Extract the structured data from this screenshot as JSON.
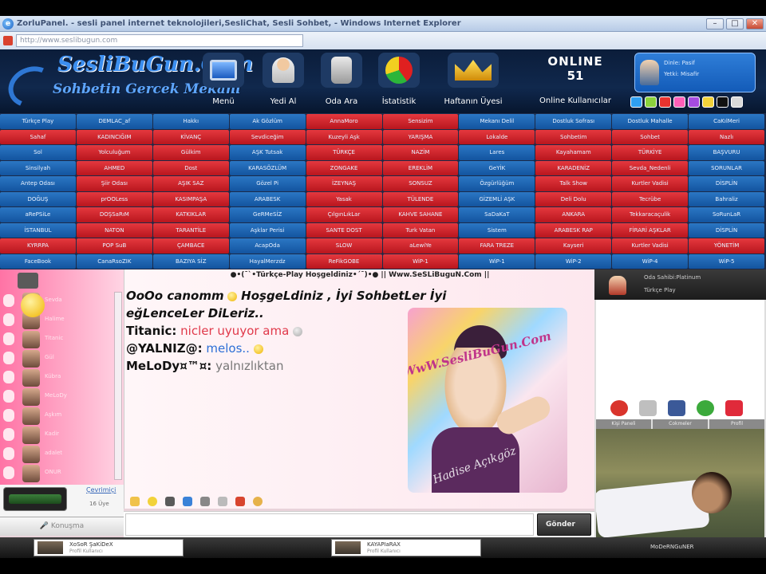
{
  "window": {
    "title": "ZorluPanel. - sesli panel internet teknolojileri,SesliChat, Sesli Sohbet, - Windows Internet Explorer",
    "url": "http://www.seslibugun.com"
  },
  "header": {
    "logo_line1": "SesliBuGun.Com",
    "logo_line2": "Sohbetin Gercek Mekani",
    "nav": [
      "Menü",
      "Yedi Al",
      "Oda Ara",
      "İstatistik",
      "Haftanın Üyesi",
      "Online Kullanıcılar"
    ],
    "online_label": "ONLINE",
    "online_count": "51",
    "user_line1": "Dinle: Pasif",
    "user_line2": "Yetki: Misafir",
    "swatch_colors": [
      "#2f9ff0",
      "#8bd13c",
      "#e8332f",
      "#ff5fb8",
      "#a64ce0",
      "#f2d23a",
      "#111111",
      "#d9d9d9"
    ]
  },
  "rooms": [
    [
      "Türkçe Play",
      "DEMLAC_af",
      "Hakkı",
      "Ak Gözlüm",
      "AnnaMoro",
      "Sensizim",
      "Mekanı Delil",
      "Dostluk Sofrası",
      "Dostluk Mahalle",
      "CaKılMeri"
    ],
    [
      "Sahaf",
      "KADINCIĞIM",
      "KİVANÇ",
      "Sevdiceğim",
      "Kuzeyli Aşk",
      "YARIŞMA",
      "Lokalde",
      "Sohbetim",
      "Sohbet",
      "Nazlı"
    ],
    [
      "Sol",
      "Yolculuğum",
      "Gülkim",
      "AŞK Tutsak",
      "TÜRKÇE",
      "NAZİM",
      "Lares",
      "Kayahamam",
      "TÜRKİYE",
      "BAŞVURU"
    ],
    [
      "Sinsilyah",
      "AHMED",
      "Dost",
      "KARASÖZLÜM",
      "ZONGAKE",
      "EREKLİM",
      "GeYİK",
      "KARADENİZ",
      "Sevda_Nedenli",
      "SORUNLAR"
    ],
    [
      "Antep Odası",
      "Şiir Odası",
      "AŞIK SAZ",
      "Gözel Pi",
      "İZEYNAŞ",
      "SONSUZ",
      "Özgürlüğüm",
      "Talk Show",
      "Kurtler Vadisi",
      "DİSPLİN"
    ],
    [
      "DOĞUŞ",
      "prOOLess",
      "KASIMPAŞA",
      "ARABESK",
      "Yasak",
      "TÜLENDE",
      "GİZEMLİ AŞK",
      "Deli Dolu",
      "Tecrübe",
      "Bahraliz"
    ],
    [
      "aRePSiLe",
      "DOŞSaRıM",
      "KATKIKLAR",
      "GeRMeSİZ",
      "ÇılgınLıkLar",
      "KAHVE SAHANE",
      "SaDaKaT",
      "ANKARA",
      "Tekkaracaçulik",
      "SoRunLaR"
    ],
    [
      "İSTANBUL",
      "NATON",
      "TARANTİLE",
      "Aşklar Perisi",
      "SANTE DOST",
      "Turk Vatan",
      "Sistem",
      "ARABESK RAP",
      "FİRARİ AŞKLAR",
      "DİSPLİN"
    ],
    [
      "KYRRPA",
      "POP SuB",
      "ÇAMBACE",
      "AcapOda",
      "SLOW",
      "aLewiYe",
      "FARA TREZE",
      "Kayseri",
      "Kurtler Vadisi",
      "YÖNETİM"
    ],
    [
      "FaceBook",
      "CanaRsoZIK",
      "BAZIYA SİZ",
      "HayalMerzdz",
      "ReFikGOBE",
      "WiP-1",
      "WiP-1",
      "WiP-2",
      "WiP-4",
      "WiP-5"
    ]
  ],
  "chat": {
    "room_header": "●•(¯`•Türkçe-Play Hoşgeldiniz•´¯)•● || Www.SeSLiBuguN.Com ||",
    "welcome_line1": "OoOo canomm",
    "welcome_line1b": "HoşgeLdiniz , İyi SohbetLer İyi",
    "welcome_line2": "eğLenceLer DiLeriz..",
    "messages": [
      {
        "nick": "Titanic:",
        "text": "nicler uyuyor ama"
      },
      {
        "nick": "@YALNIZ@:",
        "text": "melos.."
      },
      {
        "nick": "MeLoDy¤™¤:",
        "text": "yalnızlıktan"
      }
    ],
    "poster_caption": "WwW.SesliBuGun.Com",
    "poster_signature": "Hadise Açıkgöz",
    "input_placeholder": "",
    "send_label": "Gönder"
  },
  "userlist": {
    "cevrimici": "Çevrimiçi",
    "uyeler": "16 Üye",
    "konusma_label": "Konuşma",
    "names": [
      "Sevda",
      "Halime",
      "Titanic",
      "Gül",
      "Kübra",
      "MeLoDy",
      "Aşkım",
      "Kadir",
      "adalet",
      "ONUR"
    ]
  },
  "right_panel": {
    "line1": "Oda Sahibi:Platinum",
    "line2": "Türkçe Play",
    "tabs": [
      "Kişi Paneli",
      "Cokmeler",
      "Profil"
    ]
  },
  "bottom": {
    "tray1_name": "XoSoR ŞaKiDeX",
    "tray1_sub": "Profil Kullanıcı",
    "tray2_name": "KAYAPIaRAX",
    "tray2_sub": "Profil Kullanıcı",
    "right_label": "MoDeRNGuNER"
  }
}
